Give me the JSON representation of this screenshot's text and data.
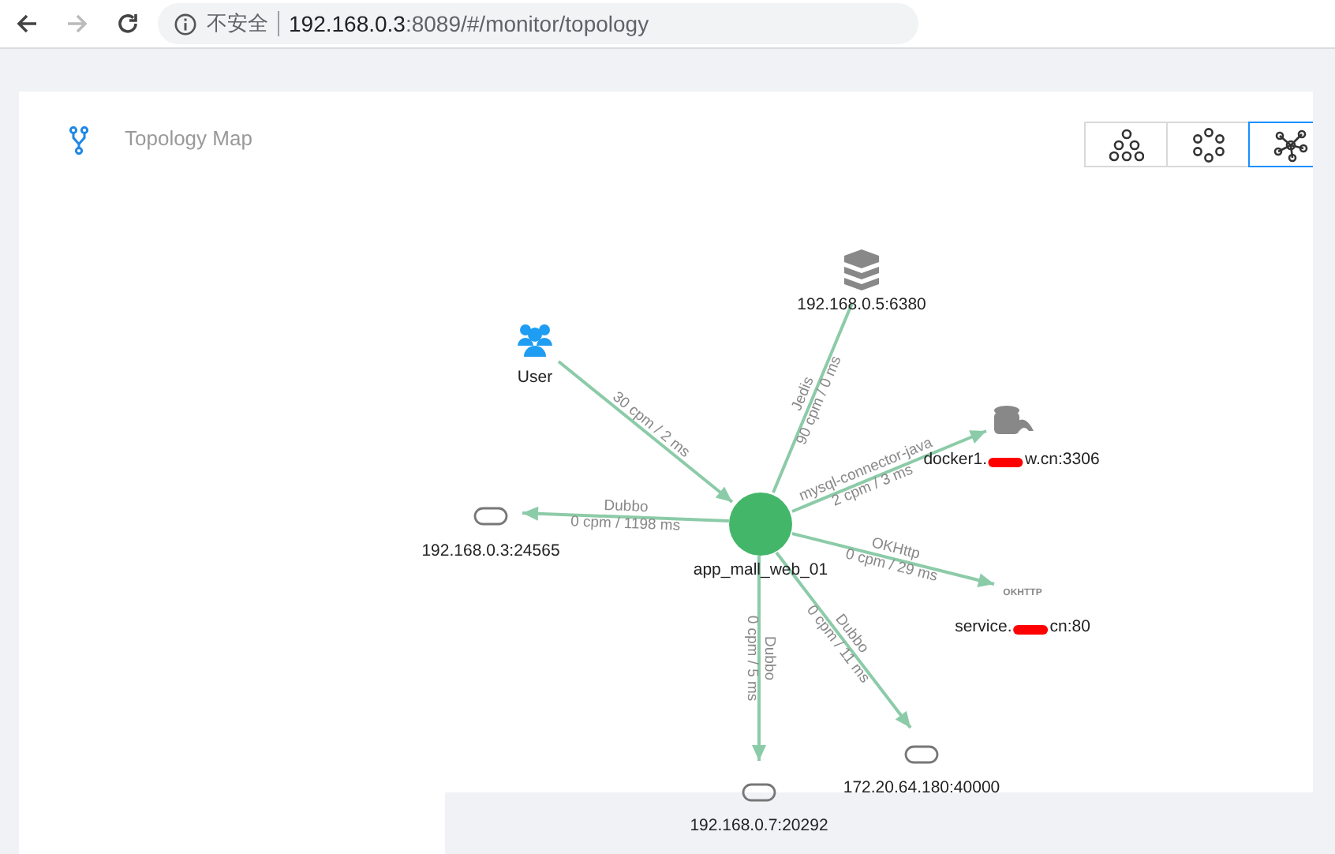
{
  "browser": {
    "security_label": "不安全",
    "url_host": "192.168.0.3",
    "url_rest": ":8089/#/monitor/topology",
    "back_disabled": false,
    "forward_disabled": true
  },
  "panel": {
    "title": "Topology Map"
  },
  "view_buttons": [
    {
      "kind": "tree",
      "selected": false
    },
    {
      "kind": "circle",
      "selected": false
    },
    {
      "kind": "star",
      "selected": true
    }
  ],
  "nodes": [
    {
      "kind": "user",
      "label": "User"
    },
    {
      "kind": "service",
      "label": "app_mall_web_01"
    },
    {
      "kind": "redis",
      "label": "192.168.0.5:6380"
    },
    {
      "kind": "mysql",
      "label": "docker1.",
      "label_end": "w.cn:3306",
      "redacted": true
    },
    {
      "kind": "dubbo",
      "label": "192.168.0.3:24565"
    },
    {
      "kind": "okhttp",
      "label": "service.",
      "label_end": "cn:80",
      "redacted": true,
      "icon_text": "OKHTTP"
    },
    {
      "kind": "dubbo",
      "label": "172.20.64.180:40000"
    },
    {
      "kind": "dubbo",
      "label": "192.168.0.7:20292"
    }
  ],
  "edges": [
    {
      "metrics": "30 cpm / 2 ms",
      "arrow": true
    },
    {
      "name": "Jedis",
      "metrics": "90 cpm / 0 ms",
      "arrow": false
    },
    {
      "name": "mysql-connector-java",
      "metrics": "2 cpm / 3 ms",
      "arrow": true
    },
    {
      "name": "Dubbo",
      "metrics": "0 cpm / 1198 ms",
      "arrow": true
    },
    {
      "name": "OKHttp",
      "metrics": "0 cpm / 29 ms",
      "arrow": true
    },
    {
      "name": "Dubbo",
      "metrics": "0 cpm / 11 ms",
      "arrow": true
    },
    {
      "name": "Dubbo",
      "metrics": "0 cpm / 5 ms",
      "arrow": true
    }
  ]
}
